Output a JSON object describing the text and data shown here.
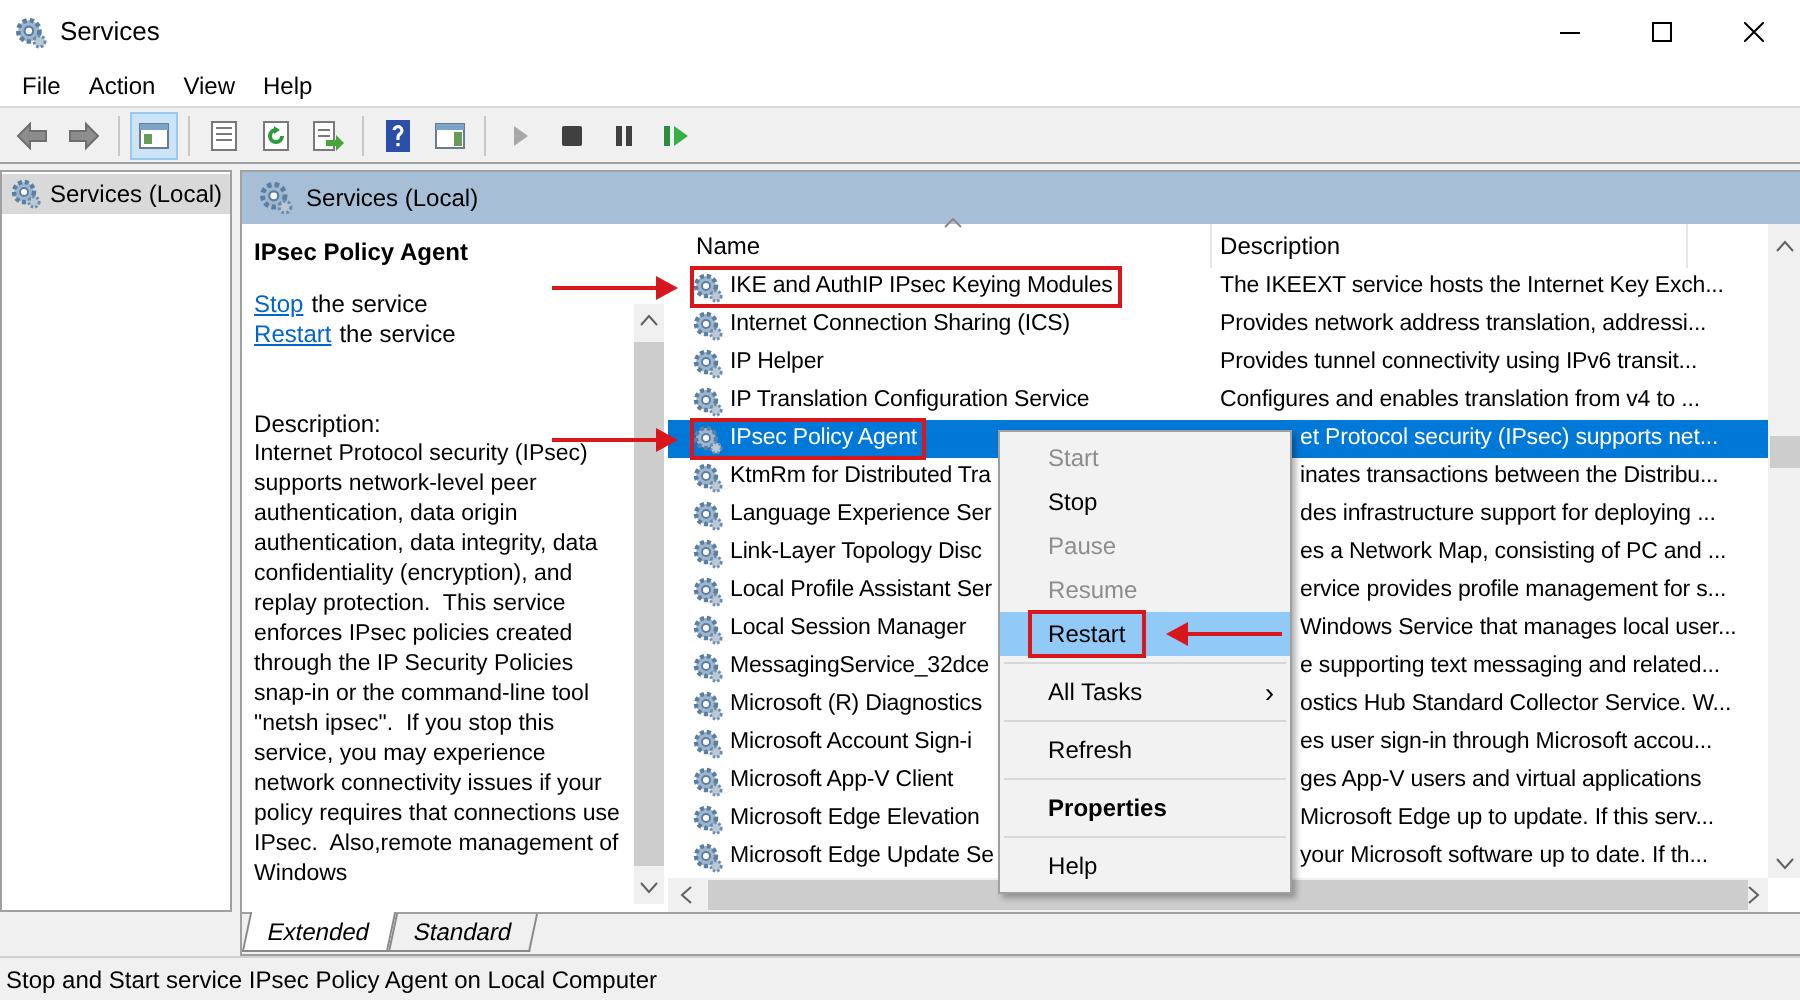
{
  "window": {
    "title": "Services"
  },
  "menu_bar": [
    "File",
    "Action",
    "View",
    "Help"
  ],
  "toolbar": [
    {
      "kind": "back",
      "disabled": false
    },
    {
      "kind": "forward",
      "disabled": false
    },
    {
      "kind": "tree",
      "selected": true
    },
    {
      "kind": "properties",
      "selected": false
    },
    {
      "kind": "refresh",
      "selected": false
    },
    {
      "kind": "export",
      "selected": false
    },
    {
      "kind": "help",
      "selected": false
    },
    {
      "kind": "pane",
      "selected": false
    },
    {
      "kind": "start",
      "disabled": true
    },
    {
      "kind": "stop",
      "disabled": false
    },
    {
      "kind": "pause",
      "disabled": false
    },
    {
      "kind": "restart",
      "disabled": false
    }
  ],
  "tree": {
    "items": [
      {
        "label": "Services (Local)",
        "selected": true
      }
    ]
  },
  "panel": {
    "title": "Services (Local)",
    "details": {
      "title": "IPsec Policy Agent",
      "links": [
        {
          "link": "Stop",
          "text": "the service"
        },
        {
          "link": "Restart",
          "text": "the service"
        }
      ],
      "description_label": "Description:",
      "description": "Internet Protocol security (IPsec) supports network-level peer authentication, data origin authentication, data integrity, data confidentiality (encryption), and replay protection.  This service enforces IPsec policies created through the IP Security Policies snap-in or the command-line tool \"netsh ipsec\".  If you stop this service, you may experience network connectivity issues if your policy requires that connections use IPsec.  Also,remote management of Windows"
    },
    "table": {
      "columns": [
        "Name",
        "Description"
      ],
      "rows": [
        {
          "name": "IKE and AuthIP IPsec Keying Modules",
          "description": "The IKEEXT service hosts the Internet Key Exch...",
          "kind": "full",
          "selected": false,
          "annotated": true
        },
        {
          "name": "Internet Connection Sharing (ICS)",
          "description": "Provides network address translation, addressi...",
          "kind": "full",
          "selected": false,
          "annotated": false
        },
        {
          "name": "IP Helper",
          "description": "Provides tunnel connectivity using IPv6 transit...",
          "kind": "full",
          "selected": false,
          "annotated": false
        },
        {
          "name": "IP Translation Configuration Service",
          "description": "Configures and enables translation from v4 to ...",
          "kind": "full",
          "selected": false,
          "annotated": false
        },
        {
          "name": "IPsec Policy Agent",
          "description": "et Protocol security (IPsec) supports net...",
          "kind": "under-menu",
          "selected": true,
          "annotated": true
        },
        {
          "name": "KtmRm for Distributed Tra",
          "description": "inates transactions between the Distribu...",
          "kind": "under-menu",
          "selected": false,
          "annotated": false
        },
        {
          "name": "Language Experience Ser",
          "description": "des infrastructure support for deploying ...",
          "kind": "under-menu",
          "selected": false,
          "annotated": false
        },
        {
          "name": "Link-Layer Topology Disc",
          "description": "es a Network Map, consisting of PC and ...",
          "kind": "under-menu",
          "selected": false,
          "annotated": false
        },
        {
          "name": "Local Profile Assistant Ser",
          "description": "ervice provides profile management for s...",
          "kind": "under-menu",
          "selected": false,
          "annotated": false
        },
        {
          "name": "Local Session Manager",
          "description": "Windows Service that manages local user...",
          "kind": "under-menu",
          "selected": false,
          "annotated": false
        },
        {
          "name": "MessagingService_32dce",
          "description": "e supporting text messaging and related...",
          "kind": "under-menu",
          "selected": false,
          "annotated": false
        },
        {
          "name": "Microsoft (R) Diagnostics",
          "description": "ostics Hub Standard Collector Service. W...",
          "kind": "under-menu",
          "selected": false,
          "annotated": false
        },
        {
          "name": "Microsoft Account Sign-i",
          "description": "es user sign-in through Microsoft accou...",
          "kind": "under-menu",
          "selected": false,
          "annotated": false
        },
        {
          "name": "Microsoft App-V Client",
          "description": "ges App-V users and virtual applications",
          "kind": "under-menu",
          "selected": false,
          "annotated": false
        },
        {
          "name": "Microsoft Edge Elevation",
          "description": "Microsoft Edge up to update. If this serv...",
          "kind": "under-menu",
          "selected": false,
          "annotated": false
        },
        {
          "name": "Microsoft Edge Update Se",
          "description": "your Microsoft software up to date. If th...",
          "kind": "under-menu",
          "selected": false,
          "annotated": false
        }
      ]
    },
    "tabs": [
      {
        "label": "Extended",
        "selected": true
      },
      {
        "label": "Standard",
        "selected": false
      }
    ]
  },
  "context_menu": [
    {
      "kind": "item",
      "label": "Start",
      "disabled": true,
      "selected": false,
      "annotated": false
    },
    {
      "kind": "item",
      "label": "Stop",
      "disabled": false,
      "selected": false,
      "annotated": false
    },
    {
      "kind": "item",
      "label": "Pause",
      "disabled": true,
      "selected": false,
      "annotated": false
    },
    {
      "kind": "item",
      "label": "Resume",
      "disabled": true,
      "selected": false,
      "annotated": false
    },
    {
      "kind": "item",
      "label": "Restart",
      "disabled": false,
      "selected": true,
      "annotated": true
    },
    {
      "kind": "separator"
    },
    {
      "kind": "submenu",
      "label": "All Tasks",
      "arrow": "›",
      "disabled": false,
      "selected": false,
      "annotated": false
    },
    {
      "kind": "separator"
    },
    {
      "kind": "item",
      "label": "Refresh",
      "disabled": false,
      "selected": false,
      "annotated": false
    },
    {
      "kind": "separator"
    },
    {
      "kind": "default",
      "label": "Properties",
      "disabled": false,
      "selected": false,
      "annotated": false
    },
    {
      "kind": "separator"
    },
    {
      "kind": "item",
      "label": "Help",
      "disabled": false,
      "selected": false,
      "annotated": false
    }
  ],
  "status_bar": "Stop and Start service IPsec Policy Agent on Local Computer"
}
